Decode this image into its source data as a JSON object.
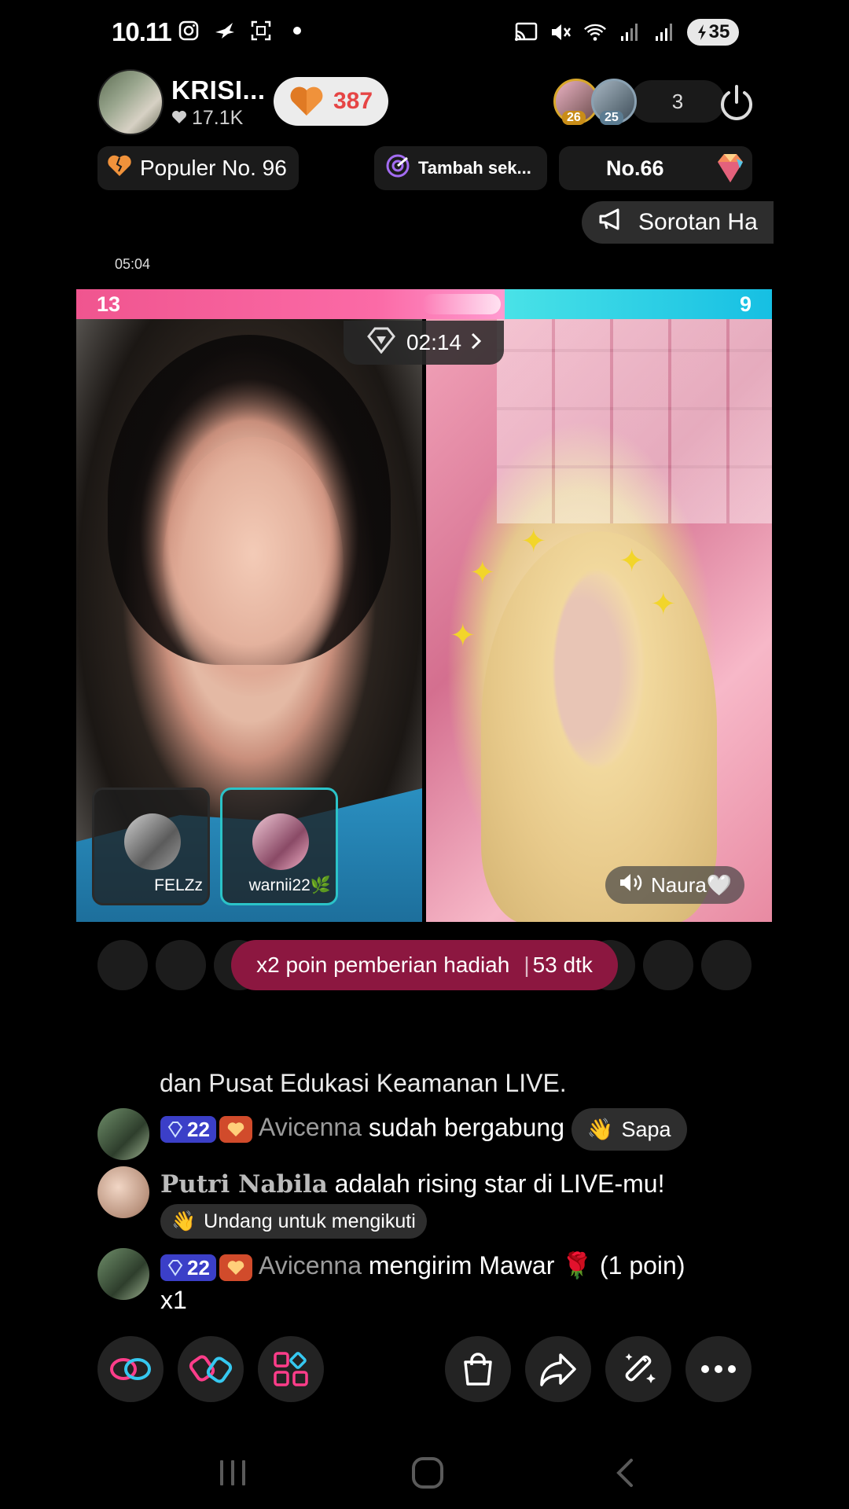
{
  "status_bar": {
    "time": "10.11",
    "battery": "35",
    "icons_left": [
      "instagram-icon",
      "bird-icon",
      "screenshot-icon",
      "dot-icon"
    ],
    "icons_right": [
      "cast-icon",
      "mute-icon",
      "wifi-icon",
      "signal-icon",
      "signal-icon",
      "battery-icon"
    ]
  },
  "header": {
    "host_name": "KRISI...",
    "host_likes": "17.1K",
    "follow_count": "387",
    "viewer_count": "3",
    "top_viewers": [
      {
        "rank": "26"
      },
      {
        "rank": "25"
      }
    ]
  },
  "badges": {
    "popular": "Populer No. 96",
    "add_time": "Tambah sek...",
    "rank": "No.66"
  },
  "sorotan": "Sorotan Ha",
  "elapsed": "05:04",
  "battle": {
    "score_left": "13",
    "score_right": "9",
    "timer": "02:14",
    "guests": [
      {
        "name": "FELZz"
      },
      {
        "name": "warnii22🌿"
      }
    ],
    "speaker": "Naura🤍"
  },
  "gift_banner": {
    "text": "x2 poin pemberian hadiah",
    "countdown": "53 dtk"
  },
  "chat": {
    "partial_top": "dan Pusat Edukasi Keamanan LIVE.",
    "messages": [
      {
        "level": "22",
        "user": "Avicenna",
        "text": "sudah bergabung",
        "action": "Sapa"
      },
      {
        "user": "Putri Nabila",
        "text": "adalah rising star di LIVE-mu!",
        "action": "Undang untuk mengikuti"
      },
      {
        "level": "22",
        "user": "Avicenna",
        "text": "mengirim Mawar 🌹 (1 poin)",
        "suffix": "x1"
      }
    ]
  },
  "colors": {
    "left_team": "#f0558f",
    "right_team": "#16bfe3",
    "gift_banner": "#8c1740",
    "level_badge": "#3b3fc8"
  }
}
